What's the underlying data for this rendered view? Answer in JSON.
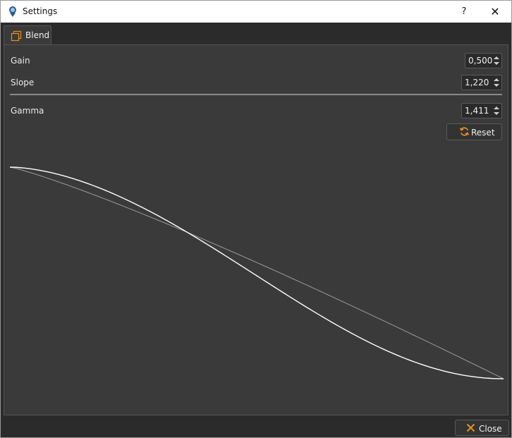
{
  "window": {
    "title": "Settings",
    "help_label": "?",
    "close_glyph": "✕",
    "app_icon": "app-icon"
  },
  "tabs": [
    {
      "label": "Blend",
      "icon": "blend-icon",
      "selected": true
    }
  ],
  "controls": {
    "gain": {
      "label": "Gain",
      "value": "0,500"
    },
    "slope": {
      "label": "Slope",
      "value": "1,220"
    },
    "gamma": {
      "label": "Gamma",
      "value": "1,411"
    }
  },
  "reset_button": {
    "label": "Reset",
    "icon": "refresh-icon"
  },
  "close_button": {
    "label": "Close",
    "icon": "close-icon"
  },
  "curve": {
    "type": "line",
    "series": [
      {
        "role": "blend-curve",
        "color": "#ffffff"
      },
      {
        "role": "reference-curve",
        "color": "#9a9a9a"
      }
    ]
  },
  "colors": {
    "accent": "#e8901c",
    "panel": "#3a3a3a",
    "background": "#2b2b2b"
  }
}
